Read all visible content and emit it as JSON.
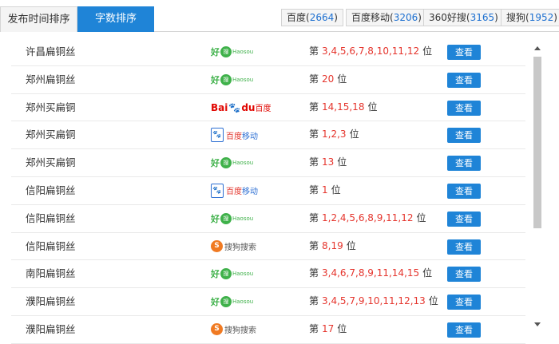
{
  "sort_tabs": [
    {
      "label": "发布时间排序",
      "active": false
    },
    {
      "label": "字数排序",
      "active": true
    }
  ],
  "engine_tabs": [
    {
      "name": "百度",
      "count": "2664"
    },
    {
      "name": "百度移动",
      "count": "3206"
    },
    {
      "name": "360好搜",
      "count": "3165"
    },
    {
      "name": "搜狗",
      "count": "1952"
    }
  ],
  "rank_prefix": "第",
  "rank_suffix": "位",
  "view_label": "查看",
  "logos": {
    "haosou": {
      "hao": "好",
      "q": "搜",
      "en": "Haosou"
    },
    "baidu": {
      "text_a": "Bai",
      "paw": "🐾",
      "text_b": "du",
      "cn": "百度"
    },
    "baidu_mobile": {
      "box": "🐾",
      "text_a": "百度",
      "text_b": "移动"
    },
    "sogou": {
      "icon": "S",
      "text": "搜狗搜索"
    }
  },
  "rows": [
    {
      "keyword": "许昌扁铜丝",
      "engine": "haosou",
      "ranks": "3,4,5,6,7,8,10,11,12"
    },
    {
      "keyword": "郑州扁铜丝",
      "engine": "haosou",
      "ranks": "20"
    },
    {
      "keyword": "郑州买扁铜",
      "engine": "baidu",
      "ranks": "14,15,18"
    },
    {
      "keyword": "郑州买扁铜",
      "engine": "baidu_mobile",
      "ranks": "1,2,3"
    },
    {
      "keyword": "郑州买扁铜",
      "engine": "haosou",
      "ranks": "13"
    },
    {
      "keyword": "信阳扁铜丝",
      "engine": "baidu_mobile",
      "ranks": "1"
    },
    {
      "keyword": "信阳扁铜丝",
      "engine": "haosou",
      "ranks": "1,2,4,5,6,8,9,11,12"
    },
    {
      "keyword": "信阳扁铜丝",
      "engine": "sogou",
      "ranks": "8,19"
    },
    {
      "keyword": "南阳扁铜丝",
      "engine": "haosou",
      "ranks": "3,4,6,7,8,9,11,14,15"
    },
    {
      "keyword": "濮阳扁铜丝",
      "engine": "haosou",
      "ranks": "3,4,5,7,9,10,11,12,13"
    },
    {
      "keyword": "濮阳扁铜丝",
      "engine": "sogou",
      "ranks": "17"
    }
  ],
  "colors": {
    "accent": "#1f84d7",
    "rank_number": "#e5352d",
    "count": "#1c6fd0"
  }
}
